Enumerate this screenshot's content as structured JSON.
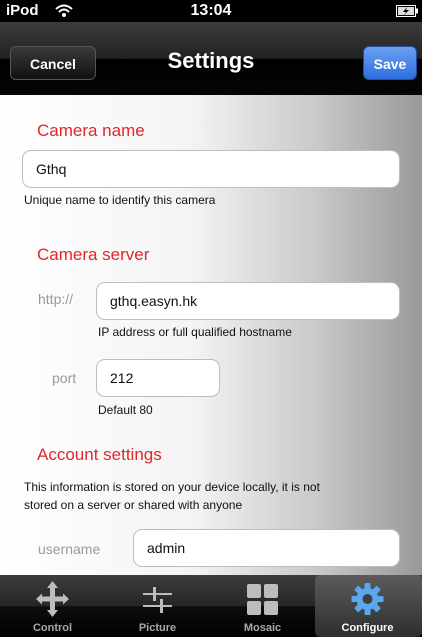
{
  "status_bar": {
    "carrier": "iPod",
    "time": "13:04"
  },
  "nav": {
    "cancel": "Cancel",
    "title": "Settings",
    "save": "Save"
  },
  "camera_name": {
    "heading": "Camera name",
    "value": "Gthq",
    "helper": "Unique name to identify this camera"
  },
  "camera_server": {
    "heading": "Camera server",
    "http_label": "http://",
    "host_value": "gthq.easyn.hk",
    "host_helper": "IP address or full qualified hostname",
    "port_label": "port",
    "port_value": "212",
    "port_helper": "Default 80"
  },
  "account": {
    "heading": "Account settings",
    "note_line1": "This information is stored on your device locally, it is not",
    "note_line2": "stored on a server or shared with anyone",
    "username_label": "username",
    "username_value": "admin"
  },
  "tabs": [
    {
      "label": "Control",
      "icon": "move-arrows-icon"
    },
    {
      "label": "Picture",
      "icon": "sliders-icon"
    },
    {
      "label": "Mosaic",
      "icon": "grid-icon"
    },
    {
      "label": "Configure",
      "icon": "gear-icon",
      "selected": true
    }
  ],
  "colors": {
    "accent_red": "#e3262a",
    "save_blue": "#2f6ee0"
  }
}
